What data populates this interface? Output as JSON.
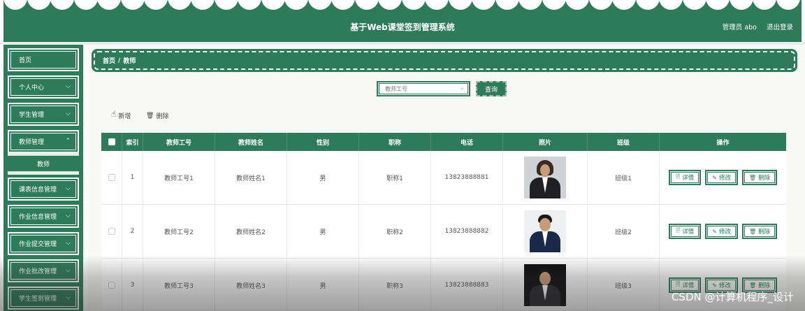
{
  "header": {
    "title": "基于Web课堂签到管理系统",
    "user_label": "管理员 abo",
    "logout_label": "退出登录"
  },
  "sidebar": {
    "items": [
      {
        "label": "首页",
        "has_chevron": false
      },
      {
        "label": "个人中心",
        "has_chevron": true
      },
      {
        "label": "学生管理",
        "has_chevron": true
      },
      {
        "label": "教师管理",
        "has_chevron": true
      },
      {
        "label": "课表信息管理",
        "has_chevron": true
      },
      {
        "label": "作业信息管理",
        "has_chevron": true
      },
      {
        "label": "作业提交管理",
        "has_chevron": true
      },
      {
        "label": "作业批改管理",
        "has_chevron": true
      },
      {
        "label": "学生签到管理",
        "has_chevron": true
      }
    ],
    "active_subitem": "教师"
  },
  "breadcrumb": {
    "home": "首页",
    "separator": "/",
    "current": "教师"
  },
  "search": {
    "placeholder": "教师工号",
    "query_label": "查询"
  },
  "actions": {
    "add_label": "新增",
    "delete_label": "删除"
  },
  "table": {
    "columns": [
      "索引",
      "教师工号",
      "教师姓名",
      "性别",
      "职称",
      "电话",
      "照片",
      "班级",
      "操作"
    ],
    "rows": [
      {
        "index": "1",
        "teacher_no": "教师工号1",
        "teacher_name": "教师姓名1",
        "gender": "男",
        "title": "职称1",
        "phone": "13823888881",
        "class": "班级1"
      },
      {
        "index": "2",
        "teacher_no": "教师工号2",
        "teacher_name": "教师姓名2",
        "gender": "男",
        "title": "职称2",
        "phone": "13823888882",
        "class": "班级2"
      },
      {
        "index": "3",
        "teacher_no": "教师工号3",
        "teacher_name": "教师姓名3",
        "gender": "男",
        "title": "职称3",
        "phone": "13823888883",
        "class": "班级3"
      }
    ],
    "row_actions": {
      "detail": "详情",
      "edit": "修改",
      "delete": "删除"
    }
  },
  "watermark": "CSDN @计算机程序_设计",
  "colors": {
    "primary": "#2e7b5a",
    "background": "#f9f9f6"
  }
}
